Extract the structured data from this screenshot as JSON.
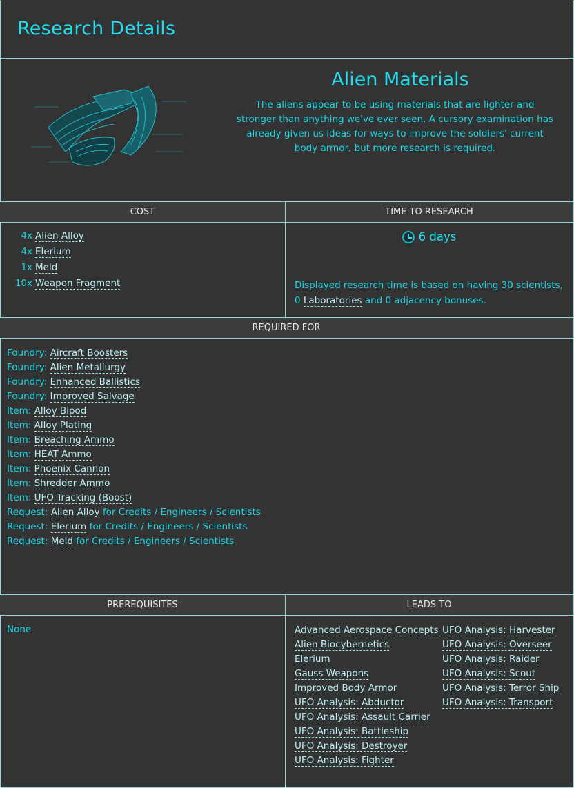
{
  "header": {
    "title": "Research Details"
  },
  "research": {
    "name": "Alien Materials",
    "description": "The aliens appear to be using materials that are lighter and stronger than anything we've ever seen. A cursory examination has already given us ideas for ways to improve the soldiers' current body armor, but more research is required.",
    "image_icon": "alien-armor-schematic"
  },
  "cost": {
    "heading": "COST",
    "items": [
      {
        "qty": "4x",
        "name": "Alien Alloy"
      },
      {
        "qty": "4x",
        "name": "Elerium"
      },
      {
        "qty": "1x",
        "name": "Meld"
      },
      {
        "qty": "10x",
        "name": "Weapon Fragment"
      }
    ]
  },
  "time": {
    "heading": "TIME TO RESEARCH",
    "value": "6 days",
    "icon": "clock-icon",
    "note_prefix": "Displayed research time is based on having 30 scientists, 0 ",
    "note_link": "Laboratories",
    "note_suffix": " and 0 adjacency bonuses."
  },
  "required_for": {
    "heading": "REQUIRED FOR",
    "items": [
      {
        "prefix": "Foundry: ",
        "link": "Aircraft Boosters",
        "suffix": ""
      },
      {
        "prefix": "Foundry: ",
        "link": "Alien Metallurgy",
        "suffix": ""
      },
      {
        "prefix": "Foundry: ",
        "link": "Enhanced Ballistics",
        "suffix": ""
      },
      {
        "prefix": "Foundry: ",
        "link": "Improved Salvage",
        "suffix": ""
      },
      {
        "prefix": "Item: ",
        "link": "Alloy Bipod",
        "suffix": ""
      },
      {
        "prefix": "Item: ",
        "link": "Alloy Plating",
        "suffix": ""
      },
      {
        "prefix": "Item: ",
        "link": "Breaching Ammo",
        "suffix": ""
      },
      {
        "prefix": "Item: ",
        "link": "HEAT Ammo",
        "suffix": ""
      },
      {
        "prefix": "Item: ",
        "link": "Phoenix Cannon",
        "suffix": ""
      },
      {
        "prefix": "Item: ",
        "link": "Shredder Ammo",
        "suffix": ""
      },
      {
        "prefix": "Item: ",
        "link": "UFO Tracking (Boost)",
        "suffix": ""
      },
      {
        "prefix": "Request: ",
        "link": "Alien Alloy",
        "suffix": " for Credits / Engineers / Scientists"
      },
      {
        "prefix": "Request: ",
        "link": "Elerium",
        "suffix": " for Credits / Engineers / Scientists"
      },
      {
        "prefix": "Request: ",
        "link": "Meld",
        "suffix": " for Credits / Engineers / Scientists"
      }
    ]
  },
  "prerequisites": {
    "heading": "PREREQUISITES",
    "value": "None"
  },
  "leads_to": {
    "heading": "LEADS TO",
    "column1": [
      "Advanced Aerospace Concepts",
      "Alien Biocybernetics",
      "Elerium",
      "Gauss Weapons",
      "Improved Body Armor",
      "UFO Analysis: Abductor",
      "UFO Analysis: Assault Carrier",
      "UFO Analysis: Battleship",
      "UFO Analysis: Destroyer",
      "UFO Analysis: Fighter"
    ],
    "column2": [
      "UFO Analysis: Harvester",
      "UFO Analysis: Overseer",
      "UFO Analysis: Raider",
      "UFO Analysis: Scout",
      "UFO Analysis: Terror Ship",
      "UFO Analysis: Transport"
    ]
  },
  "colors": {
    "background": "#333333",
    "accent": "#22dcef",
    "link": "#b9eef2",
    "border": "#8fd6da",
    "section_header": "#3c3c3c"
  }
}
